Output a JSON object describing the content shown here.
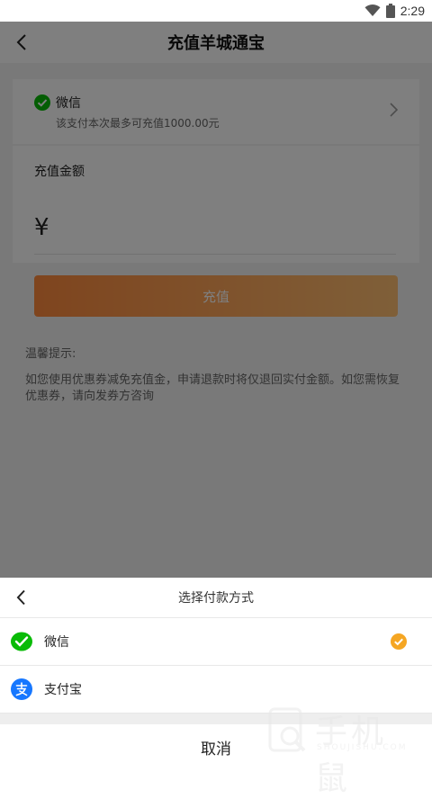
{
  "status_bar": {
    "time": "2:29"
  },
  "nav": {
    "title": "充值羊城通宝"
  },
  "payment_card": {
    "method": "微信",
    "tip": "该支付本次最多可充值1000.00元"
  },
  "amount": {
    "label": "充值金额",
    "currency": "¥"
  },
  "charge_button": "充值",
  "notice": {
    "title": "温馨提示:",
    "body": "如您使用优惠券减免充值金，申请退款时将仅退回实付金额。如您需恢复优惠券，请向发券方咨询"
  },
  "sheet": {
    "title": "选择付款方式",
    "options": [
      {
        "label": "微信",
        "icon": "wechat-icon",
        "selected": true
      },
      {
        "label": "支付宝",
        "icon": "alipay-icon",
        "selected": false
      }
    ],
    "cancel": "取消"
  },
  "watermark": {
    "brand": "手机鼠",
    "sub": "SHOUJISHU.COM"
  },
  "colors": {
    "wechat": "#09bb07",
    "alipay": "#1677ff",
    "check": "#f5a623",
    "button": "#ff8a3d"
  }
}
